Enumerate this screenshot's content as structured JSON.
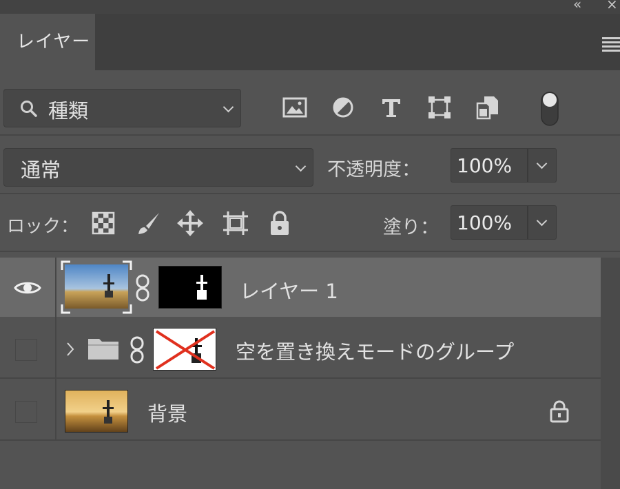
{
  "window": {
    "collapse_glyph": "«",
    "close_glyph": "×"
  },
  "panel": {
    "tab_label": "レイヤー"
  },
  "filter": {
    "kind_label": "種類",
    "icons": [
      "image-filter-icon",
      "adjustment-filter-icon",
      "type-filter-icon",
      "shape-filter-icon",
      "smart-object-filter-icon",
      "filter-toggle-icon"
    ]
  },
  "blend": {
    "mode": "通常",
    "opacity_label": "不透明度：",
    "opacity_value": "100%"
  },
  "lock": {
    "label": "ロック：",
    "icons": [
      "lock-transparent-pixels-icon",
      "lock-image-pixels-icon",
      "lock-position-icon",
      "lock-artboard-icon",
      "lock-all-icon"
    ],
    "fill_label": "塗り：",
    "fill_value": "100%"
  },
  "layers": [
    {
      "name": "レイヤー 1",
      "visible": true,
      "selected": true,
      "has_mask": true
    },
    {
      "name": "空を置き換えモードのグループ",
      "visible": false,
      "type": "group",
      "mask_disabled": true
    },
    {
      "name": "背景",
      "visible": false,
      "locked": true
    }
  ],
  "colors": {
    "panel": "#535353",
    "selected_row": "#6a6a6a",
    "disabled_mask_x": "#e0301e"
  }
}
